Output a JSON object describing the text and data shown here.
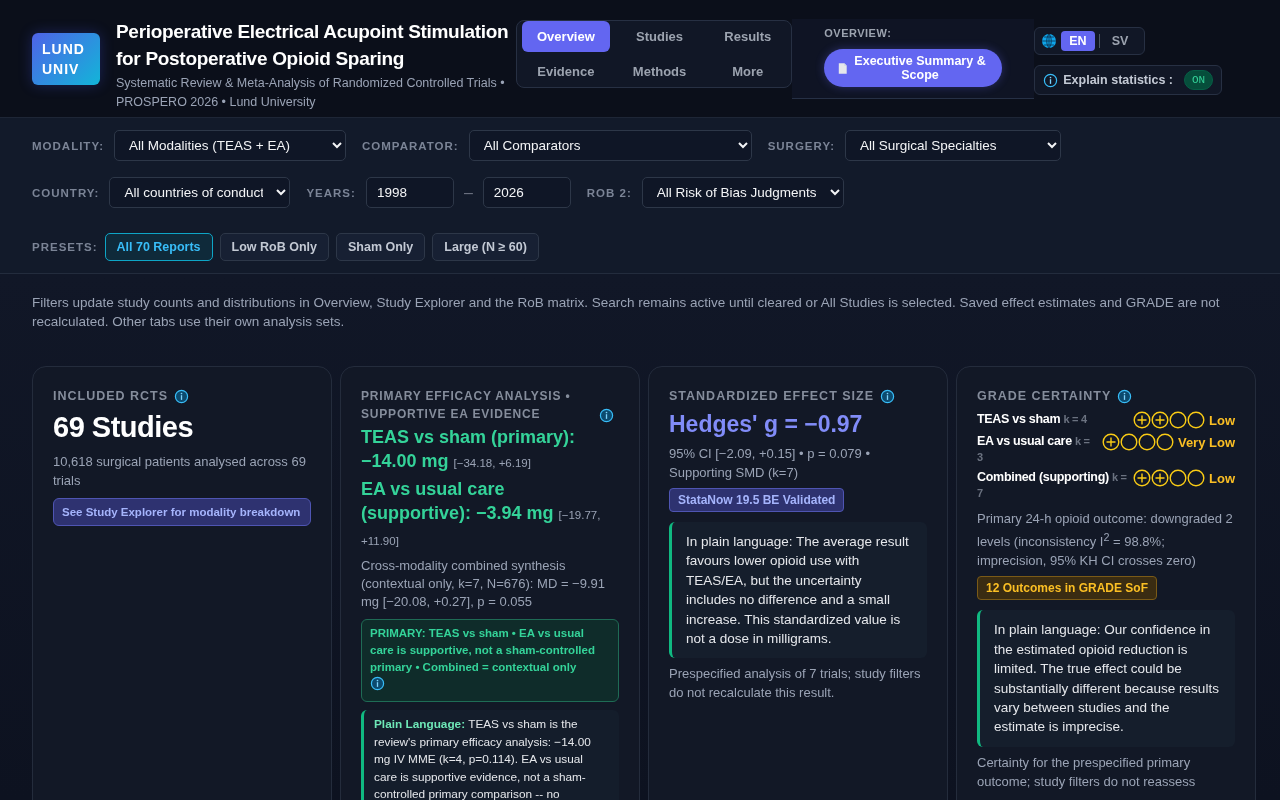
{
  "header": {
    "logo": [
      "LUND",
      "UNIV"
    ],
    "title": "Perioperative Electrical Acupoint Stimulation for Postoperative Opioid Sparing",
    "subtitle": "Systematic Review & Meta-Analysis of Randomized Controlled Trials • PROSPERO 2026 • Lund University"
  },
  "tabs": [
    {
      "label": "Overview",
      "selected": true
    },
    {
      "label": "Studies",
      "selected": false
    },
    {
      "label": "Results",
      "selected": false
    },
    {
      "label": "Evidence",
      "selected": false
    },
    {
      "label": "Methods",
      "selected": false
    },
    {
      "label": "More",
      "selected": false
    }
  ],
  "section": {
    "label": "OVERVIEW:",
    "button": "Executive Summary & Scope"
  },
  "language": [
    {
      "label": "EN",
      "selected": true
    },
    {
      "label": "SV",
      "selected": false
    }
  ],
  "explain": {
    "label": "Explain statistics :",
    "toggle": "ON",
    "on": true
  },
  "filter_rows": [
    [
      {
        "kind": "select",
        "label": "MODALITY:",
        "value": "All Modalities (TEAS + EA)"
      },
      {
        "kind": "select",
        "label": "COMPARATOR:",
        "value": "All Comparators"
      },
      {
        "kind": "select",
        "label": "SURGERY:",
        "value": "All Surgical Specialties"
      }
    ],
    [
      {
        "kind": "select",
        "label": "COUNTRY:",
        "value": "All countries of conduct"
      },
      {
        "kind": "range",
        "label": "YEARS:",
        "from": "1998",
        "separator": "–",
        "to": "2026"
      },
      {
        "kind": "select",
        "label": "ROB 2:",
        "value": "All Risk of Bias Judgments"
      }
    ]
  ],
  "presets": {
    "label": "PRESETS:",
    "items": [
      {
        "label": "All 70 Reports",
        "selected": true
      },
      {
        "label": "Low RoB Only",
        "selected": false
      },
      {
        "label": "Sham Only",
        "selected": false
      },
      {
        "label": "Large (N ≥ 60)",
        "selected": false
      }
    ]
  },
  "note": "Filters update study counts and distributions in Overview, Study Explorer and the RoB matrix. Search remains active until cleared or All Studies is selected. Saved effect estimates and GRADE are not recalculated. Other tabs use their own analysis sets.",
  "cards": [
    {
      "kind": "count",
      "title": "INCLUDED RCTS",
      "value": "69 Studies",
      "detail": "10,618 surgical patients analysed across 69 trials",
      "link": "See Study Explorer for modality breakdown"
    },
    {
      "kind": "efficacy",
      "title": "PRIMARY EFFICACY ANALYSIS • SUPPORTIVE EA EVIDENCE",
      "results": [
        {
          "text": "TEAS vs sham (primary): −14.00 mg",
          "ci": "[−34.18, +6.19]"
        },
        {
          "text": "EA vs usual care (supportive): −3.94 mg",
          "ci": "[−19.77, +11.90]"
        }
      ],
      "detail": "Cross-modality combined synthesis (contextual only, k=7, N=676): MD = −9.91 mg [−20.08, +0.27], p = 0.055",
      "callout": "PRIMARY: TEAS vs sham • EA vs usual care is supportive, not a sham-controlled primary • Combined = contextual only",
      "plain": "**Plain Language:** TEAS vs sham is the review's primary efficacy analysis: −14.00 mg IV MME (k=4, p=0.114). EA vs usual care is supportive evidence, not a sham-controlled primary comparison -- no"
    },
    {
      "kind": "effect",
      "title": "STANDARDIZED EFFECT SIZE",
      "value": "Hedges' g = −0.97",
      "detail": "95% CI [−2.09, +0.15] • p = 0.079 • Supporting SMD (k=7)",
      "badge": "StataNow 19.5 BE Validated",
      "plain": "In plain language: The average result favours lower opioid use with TEAS/EA, but the uncertainty includes no difference and a small increase. This standardized value is not a dose in milligrams.",
      "footnote": "Prespecified analysis of 7 trials; study filters do not recalculate this result."
    },
    {
      "kind": "grade",
      "title": "GRADE CERTAINTY",
      "rows": [
        {
          "name": "TEAS vs sham",
          "k": "k = 4",
          "stars": 2,
          "rating": "Low"
        },
        {
          "name": "EA vs usual care",
          "k": "k = 3",
          "stars": 1,
          "rating": "Very Low"
        },
        {
          "name": "Combined (supporting)",
          "k": "k = 7",
          "stars": 2,
          "rating": "Low"
        }
      ],
      "detail": "Primary 24-h opioid outcome: downgraded 2 levels (inconsistency I$^{2}$ = 98.8%; imprecision, 95% KH CI crosses zero)",
      "badge": "12 Outcomes in GRADE SoF",
      "plain": "In plain language: Our confidence in the estimated opioid reduction is limited. The true effect could be substantially different because results vary between studies and the estimate is imprecise.",
      "footnote": "Certainty for the prespecified primary outcome; study filters do not reassess"
    }
  ]
}
